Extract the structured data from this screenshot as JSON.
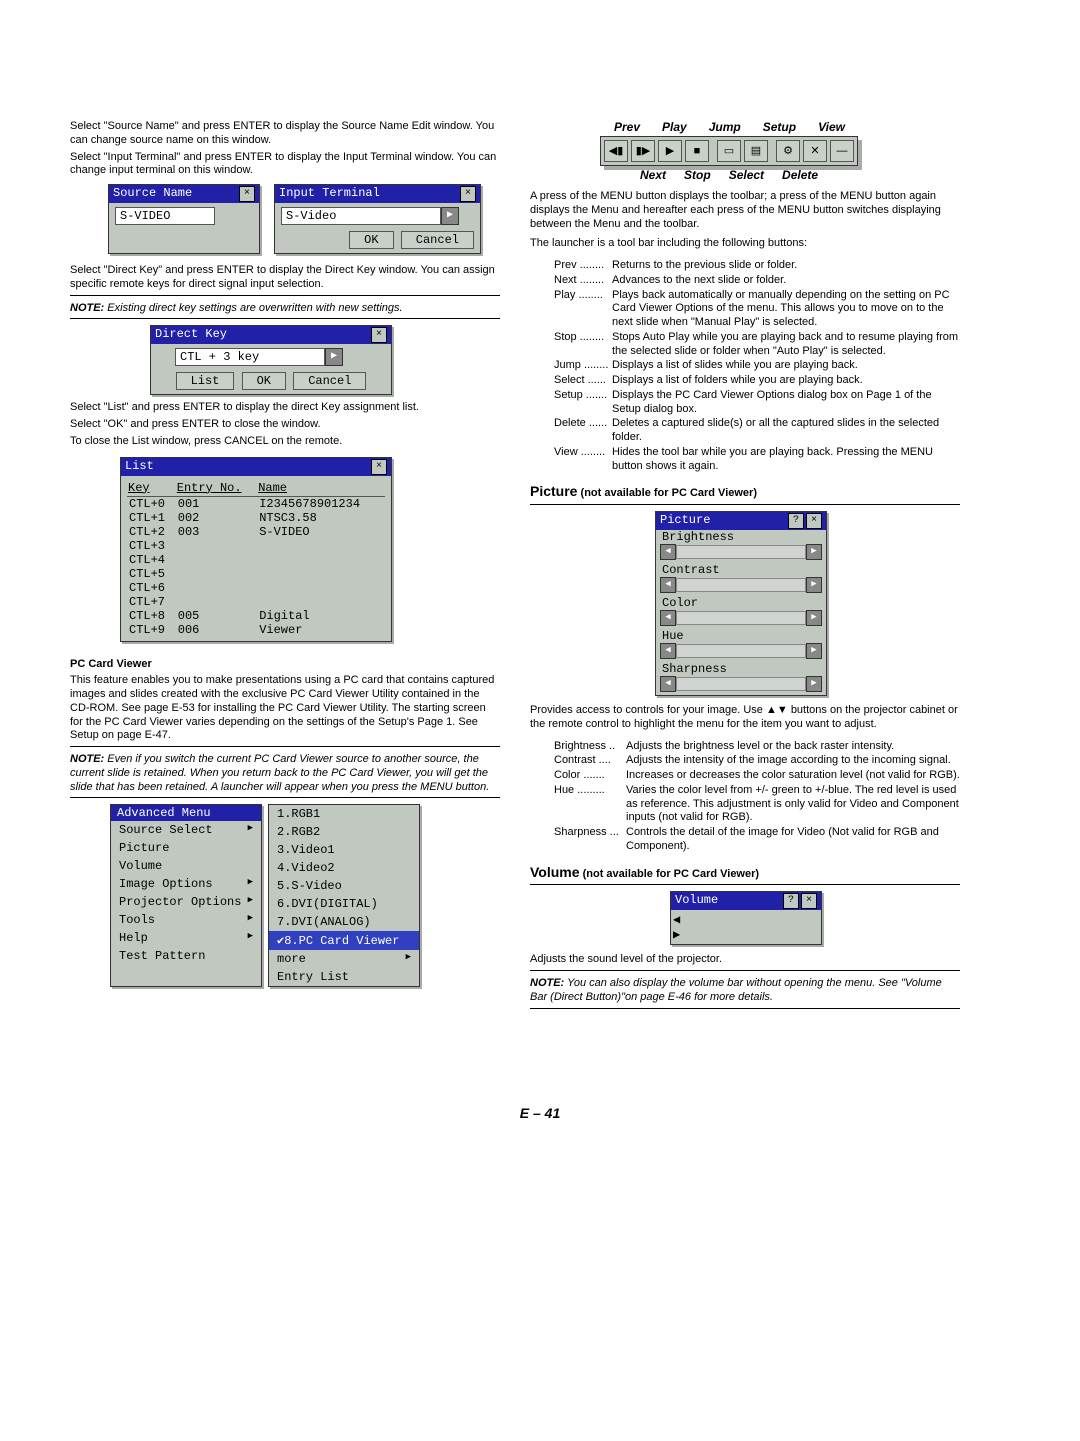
{
  "left": {
    "p1": "Select \"Source Name\" and press ENTER to display the Source Name Edit window. You can change source name on this window.",
    "p2": "Select \"Input Terminal\" and press ENTER to display the Input Terminal window. You can change input terminal on this window.",
    "source_name_win": {
      "title": "Source Name",
      "value": "S-VIDEO"
    },
    "input_term_win": {
      "title": "Input Terminal",
      "value": "S-Video",
      "ok": "OK",
      "cancel": "Cancel"
    },
    "p3": "Select \"Direct Key\" and press ENTER to display the Direct Key window. You can assign specific remote keys for direct signal input selection.",
    "note1": "NOTE: Existing direct key settings are overwritten with new settings.",
    "direct_key_win": {
      "title": "Direct Key",
      "value": "CTL + 3 key",
      "list": "List",
      "ok": "OK",
      "cancel": "Cancel"
    },
    "p4": "Select \"List\" and press ENTER to display the direct Key assignment list.",
    "p5": "Select \"OK\" and press ENTER to close the window.",
    "p6": "To close the List window, press CANCEL on the remote.",
    "list_win": {
      "title": "List",
      "headers": [
        "Key",
        "Entry No.",
        "Name"
      ],
      "rows": [
        [
          "CTL+0",
          "001",
          "I2345678901234"
        ],
        [
          "CTL+1",
          "002",
          "NTSC3.58"
        ],
        [
          "CTL+2",
          "003",
          "S-VIDEO"
        ],
        [
          "CTL+3",
          "",
          ""
        ],
        [
          "CTL+4",
          "",
          ""
        ],
        [
          "CTL+5",
          "",
          ""
        ],
        [
          "CTL+6",
          "",
          ""
        ],
        [
          "CTL+7",
          "",
          ""
        ],
        [
          "CTL+8",
          "005",
          "Digital"
        ],
        [
          "CTL+9",
          "006",
          "Viewer"
        ]
      ]
    },
    "pc_title": "PC Card Viewer",
    "pc_body": "This feature enables you to make presentations using a PC card that contains captured images and slides created with the exclusive PC Card Viewer Utility contained in the CD-ROM. See page E-53 for installing the PC Card Viewer Utility. The starting screen for the PC Card Viewer varies depending on the settings of the Setup's Page 1. See Setup on page E-47.",
    "pc_note": "NOTE: Even if you switch the current PC Card Viewer source to another source, the current slide is retained. When you return back to the PC Card Viewer, you will get the slide that has been retained. A launcher will appear when you press the MENU button.",
    "adv_menu": {
      "title": "Advanced Menu",
      "items": [
        {
          "label": "Source Select",
          "sub": true
        },
        {
          "label": "Picture",
          "sub": false
        },
        {
          "label": "Volume",
          "sub": false
        },
        {
          "label": "Image Options",
          "sub": true
        },
        {
          "label": "Projector Options",
          "sub": true
        },
        {
          "label": "Tools",
          "sub": true
        },
        {
          "label": "Help",
          "sub": true
        },
        {
          "label": "Test Pattern",
          "sub": false
        }
      ]
    },
    "sub_menu": {
      "items": [
        "1.RGB1",
        "2.RGB2",
        "3.Video1",
        "4.Video2",
        "5.S-Video",
        "6.DVI(DIGITAL)",
        "7.DVI(ANALOG)",
        "✔8.PC Card Viewer",
        "more",
        "Entry List"
      ],
      "highlight": 7,
      "more_sub": true
    }
  },
  "right": {
    "tb_top": [
      "Prev",
      "Play",
      "Jump",
      "Setup",
      "View"
    ],
    "tb_bottom": [
      "Next",
      "Stop",
      "Select",
      "Delete"
    ],
    "tb_icons": [
      "◀▮",
      "▮▶",
      "▶",
      "■",
      "▭",
      "▤",
      "⚙",
      "✕",
      "—"
    ],
    "p1": "A press of the MENU button displays the toolbar; a press of the MENU button again displays the Menu and hereafter each press of the MENU button switches displaying between the Menu and the toolbar.",
    "p2": "The launcher is a tool bar including the following buttons:",
    "defs": [
      {
        "t": "Prev",
        "d": "Returns to the previous slide or folder."
      },
      {
        "t": "Next",
        "d": "Advances to the next slide or folder."
      },
      {
        "t": "Play",
        "d": "Plays back automatically or manually depending on the setting on PC Card Viewer Options of the menu. This allows you to move on to the next slide when \"Manual Play\" is selected."
      },
      {
        "t": "Stop",
        "d": "Stops Auto Play while you are playing back and to resume playing from the selected slide or folder when \"Auto Play\" is selected."
      },
      {
        "t": "Jump",
        "d": "Displays a list of slides while you are playing back."
      },
      {
        "t": "Select",
        "d": "Displays a list of folders while you are playing back."
      },
      {
        "t": "Setup",
        "d": "Displays the PC Card Viewer Options dialog box on Page 1 of the Setup dialog box."
      },
      {
        "t": "Delete",
        "d": "Deletes a captured slide(s) or all the captured slides in the selected folder."
      },
      {
        "t": "View",
        "d": "Hides the tool bar while you are playing back. Pressing the MENU button shows it again."
      }
    ],
    "pic_title_big": "Picture",
    "pic_title_small": "(not available for PC Card Viewer)",
    "pic_panel": {
      "title": "Picture",
      "items": [
        "Brightness",
        "Contrast",
        "Color",
        "Hue",
        "Sharpness"
      ]
    },
    "pic_body": "Provides access to controls for your image. Use ▲▼ buttons on the projector cabinet or the remote control to highlight the menu for the item you want to adjust.",
    "pic_defs": [
      {
        "t": "Brightness",
        "d": "Adjusts the brightness level or the back raster intensity."
      },
      {
        "t": "Contrast",
        "d": "Adjusts the intensity of the image according to the incoming signal."
      },
      {
        "t": "Color",
        "d": "Increases or decreases the color saturation level (not valid for RGB)."
      },
      {
        "t": "Hue",
        "d": "Varies the color level from +/- green to +/-blue. The red level is used as reference. This adjustment is only valid for Video and Component inputs (not valid for RGB)."
      },
      {
        "t": "Sharpness",
        "d": "Controls the detail of the image for Video (Not valid for RGB and Component)."
      }
    ],
    "vol_title_big": "Volume",
    "vol_title_small": "(not available for PC Card Viewer)",
    "vol_panel": {
      "title": "Volume"
    },
    "vol_body": "Adjusts the sound level of the projector.",
    "vol_note": "NOTE: You can also display the volume bar without opening the menu. See \"Volume Bar (Direct Button)\"on page E-46 for more details."
  },
  "page_num": "E – 41"
}
